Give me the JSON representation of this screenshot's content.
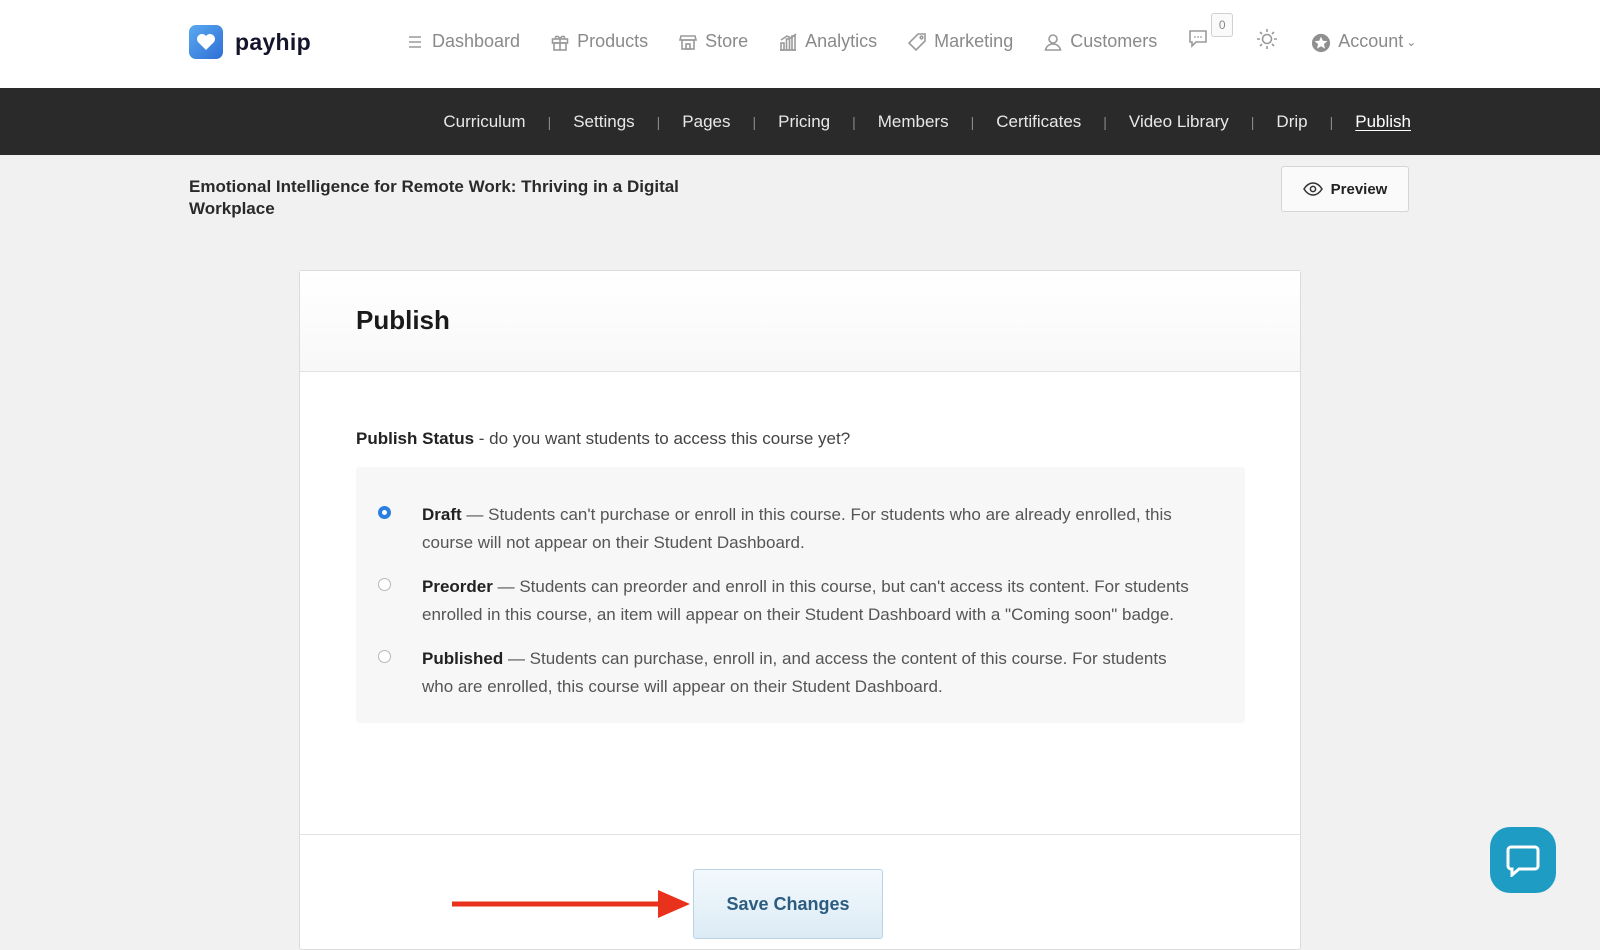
{
  "brand": {
    "name": "payhip"
  },
  "nav": {
    "items": [
      {
        "label": "Dashboard",
        "icon": "menu-icon"
      },
      {
        "label": "Products",
        "icon": "gift-icon"
      },
      {
        "label": "Store",
        "icon": "store-icon"
      },
      {
        "label": "Analytics",
        "icon": "analytics-icon"
      },
      {
        "label": "Marketing",
        "icon": "tag-icon"
      },
      {
        "label": "Customers",
        "icon": "user-icon"
      }
    ],
    "messages_count": "0",
    "account_label": "Account"
  },
  "course_nav": {
    "items": [
      "Curriculum",
      "Settings",
      "Pages",
      "Pricing",
      "Members",
      "Certificates",
      "Video Library",
      "Drip",
      "Publish"
    ],
    "active": "Publish"
  },
  "course": {
    "title": "Emotional Intelligence for Remote Work: Thriving in a Digital Workplace",
    "preview_label": "Preview"
  },
  "publish": {
    "heading": "Publish",
    "status_label": "Publish Status",
    "status_question": " - do you want students to access this course yet?",
    "options": [
      {
        "name": "Draft",
        "desc": " — Students can't purchase or enroll in this course. For students who are already enrolled, this course will not appear on their Student Dashboard.",
        "selected": true
      },
      {
        "name": "Preorder",
        "desc": " — Students can preorder and enroll in this course, but can't access its content. For students enrolled in this course, an item will appear on their Student Dashboard with a \"Coming soon\" badge.",
        "selected": false
      },
      {
        "name": "Published",
        "desc": " — Students can purchase, enroll in, and access the content of this course. For students who are enrolled, this course will appear on their Student Dashboard.",
        "selected": false
      }
    ],
    "save_label": "Save Changes"
  },
  "colors": {
    "accent": "#2a7fe0",
    "dark_nav": "#2a2a2a",
    "annotation_arrow": "#e8321c",
    "chat": "#1e9cc4"
  }
}
